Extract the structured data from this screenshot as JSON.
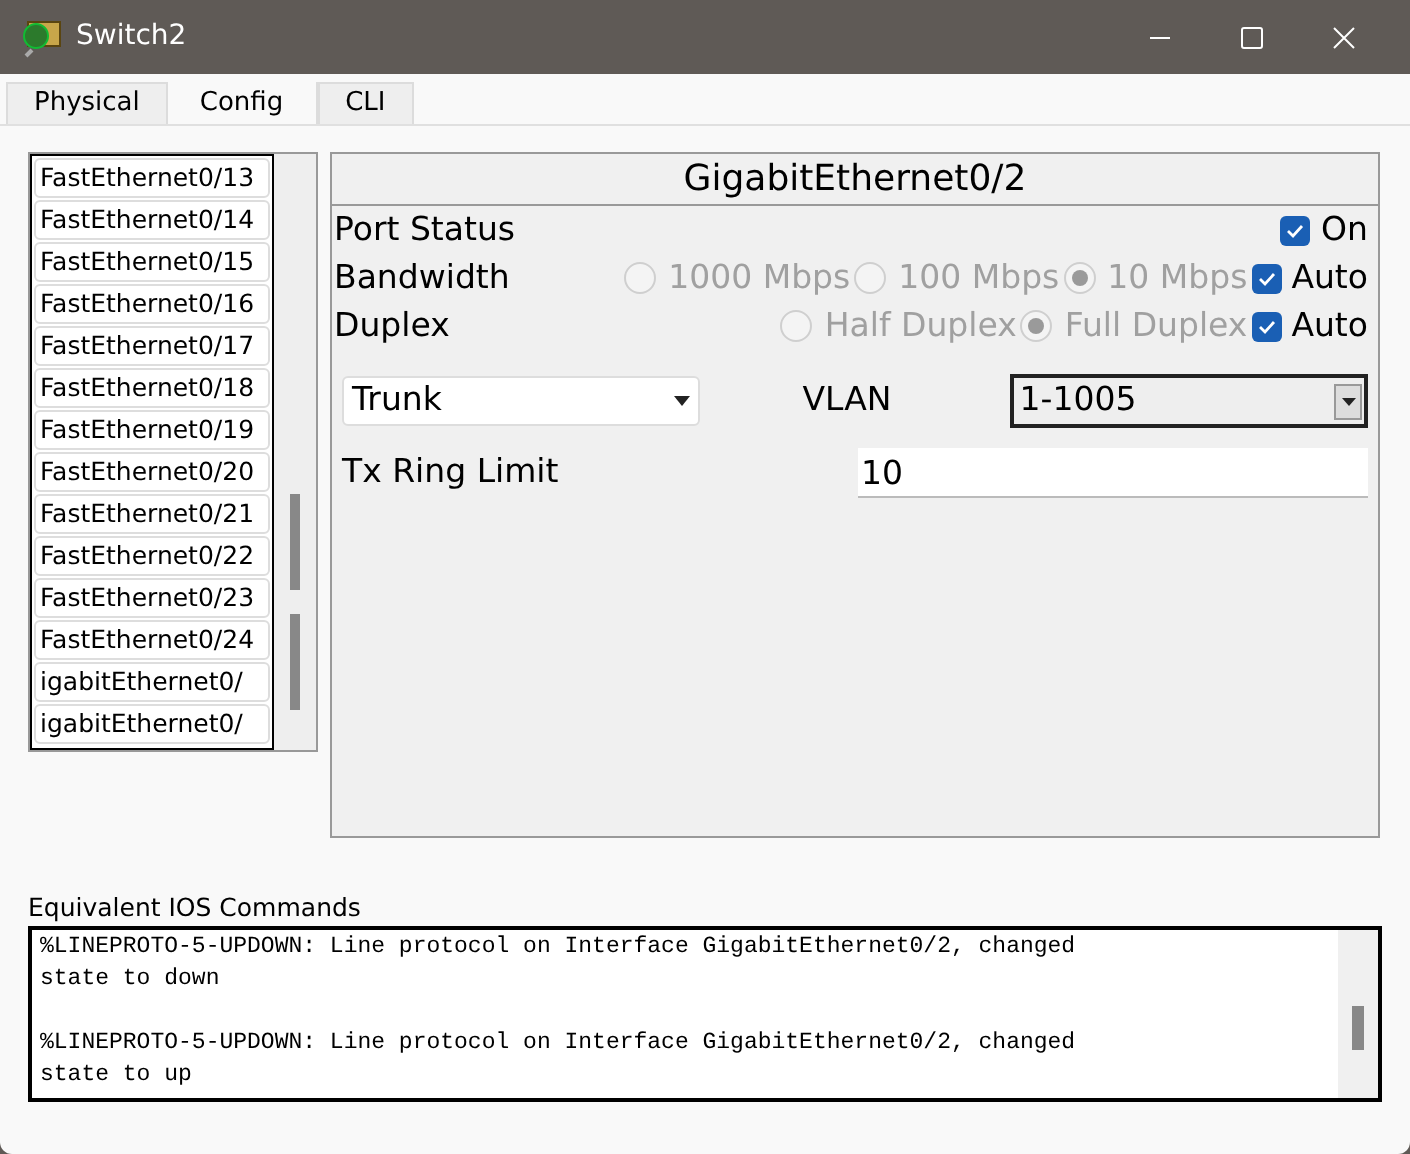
{
  "window": {
    "title": "Switch2"
  },
  "tabs": [
    {
      "label": "Physical",
      "selected": false
    },
    {
      "label": "Config",
      "selected": true
    },
    {
      "label": "CLI",
      "selected": false
    }
  ],
  "interfaces": [
    {
      "label": "FastEthernet0/13",
      "selected": false
    },
    {
      "label": "FastEthernet0/14",
      "selected": false
    },
    {
      "label": "FastEthernet0/15",
      "selected": false
    },
    {
      "label": "FastEthernet0/16",
      "selected": false
    },
    {
      "label": "FastEthernet0/17",
      "selected": false
    },
    {
      "label": "FastEthernet0/18",
      "selected": false
    },
    {
      "label": "FastEthernet0/19",
      "selected": false
    },
    {
      "label": "FastEthernet0/20",
      "selected": false
    },
    {
      "label": "FastEthernet0/21",
      "selected": false
    },
    {
      "label": "FastEthernet0/22",
      "selected": false
    },
    {
      "label": "FastEthernet0/23",
      "selected": false
    },
    {
      "label": "FastEthernet0/24",
      "selected": false
    },
    {
      "label": "igabitEthernet0/",
      "selected": false
    },
    {
      "label": "igabitEthernet0/",
      "selected": false
    }
  ],
  "panel": {
    "title": "GigabitEthernet0/2",
    "port_status": {
      "label": "Port Status",
      "checkbox": {
        "label": "On",
        "checked": true
      }
    },
    "bandwidth": {
      "label": "Bandwidth",
      "options": [
        {
          "label": "1000 Mbps",
          "selected": false
        },
        {
          "label": "100 Mbps",
          "selected": false
        },
        {
          "label": "10 Mbps",
          "selected": true
        }
      ],
      "disabled": true,
      "auto": {
        "label": "Auto",
        "checked": true
      }
    },
    "duplex": {
      "label": "Duplex",
      "options": [
        {
          "label": "Half Duplex",
          "selected": false
        },
        {
          "label": "Full Duplex",
          "selected": true
        }
      ],
      "disabled": true,
      "auto": {
        "label": "Auto",
        "checked": true
      }
    },
    "mode": {
      "value": "Trunk"
    },
    "vlan": {
      "label": "VLAN",
      "value": "1-1005"
    },
    "tx_ring_limit": {
      "label": "Tx Ring Limit",
      "value": "10"
    }
  },
  "console": {
    "label": "Equivalent IOS Commands",
    "messages": [
      {
        "lines": [
          "%LINEPROTO-5-UPDOWN: Line protocol on Interface GigabitEthernet0/2, changed",
          "state to down"
        ]
      },
      {
        "lines": [
          "%LINEPROTO-5-UPDOWN: Line protocol on Interface GigabitEthernet0/2, changed",
          "state to up"
        ]
      }
    ]
  }
}
